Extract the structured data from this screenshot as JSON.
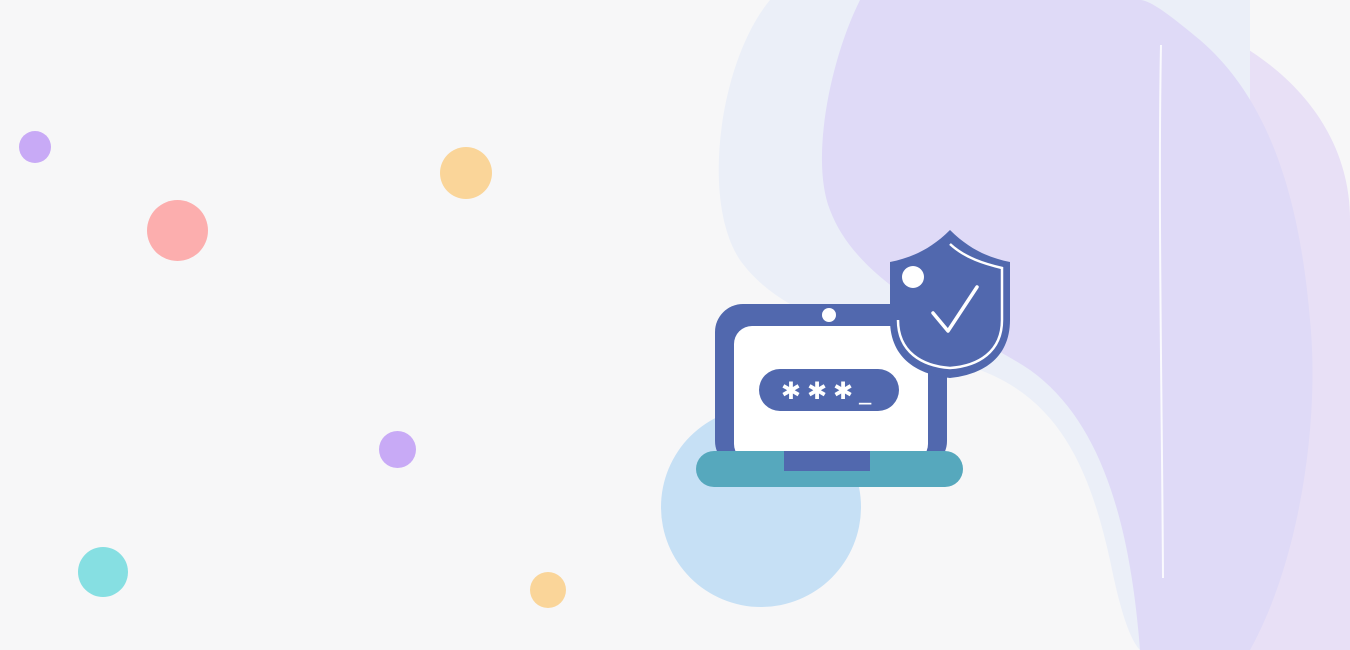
{
  "colors": {
    "background": "#f7f7f8",
    "blob_far": "#e8e0f6",
    "blob_mid": "#dfdaf7",
    "blob_light": "#ebeff8",
    "accent_circle": "#c6e0f5",
    "laptop_frame": "#5168ae",
    "laptop_screen": "#ffffff",
    "laptop_base": "#56a8bd",
    "shield": "#5168ae",
    "dot_purple": "#c8aaf6",
    "dot_pink": "#fcaeae",
    "dot_yellow": "#fad599",
    "dot_teal": "#86dfe2"
  },
  "illustration": {
    "password_mask": "✱✱✱_",
    "icons": [
      "laptop-icon",
      "password-field-icon",
      "shield-check-icon"
    ]
  }
}
